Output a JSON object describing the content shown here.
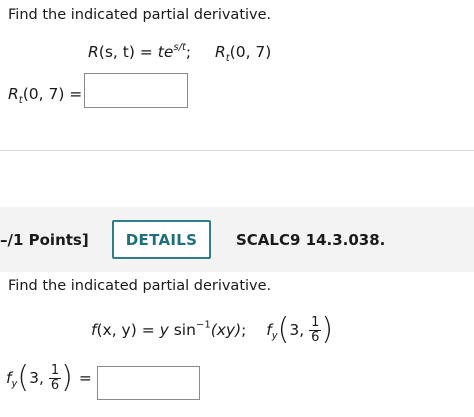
{
  "problem1": {
    "instruction": "Find the indicated partial derivative.",
    "func_name": "R",
    "func_args": "(s, t) = ",
    "func_t": "t",
    "func_e": "e",
    "func_exp": "s/t",
    "semicolon": ";",
    "target_name": "R",
    "target_sub": "t",
    "target_args": "(0, 7)",
    "answer_label_args": "(0, 7) =",
    "answer_value": ""
  },
  "header": {
    "points": "–/1 Points]",
    "details_label": "DETAILS",
    "problem_code": "SCALC9 14.3.038."
  },
  "problem2": {
    "instruction": "Find the indicated partial derivative.",
    "func_f": "f",
    "func_args": "(x, y) = ",
    "func_y": "y",
    "func_sin": " sin",
    "func_sup": "−1",
    "func_arg": "(xy)",
    "semicolon": ";",
    "target_f": "f",
    "target_sub": "y",
    "target_first": "3, ",
    "frac_num": "1",
    "frac_den": "6",
    "equals": "=",
    "answer_value": ""
  }
}
